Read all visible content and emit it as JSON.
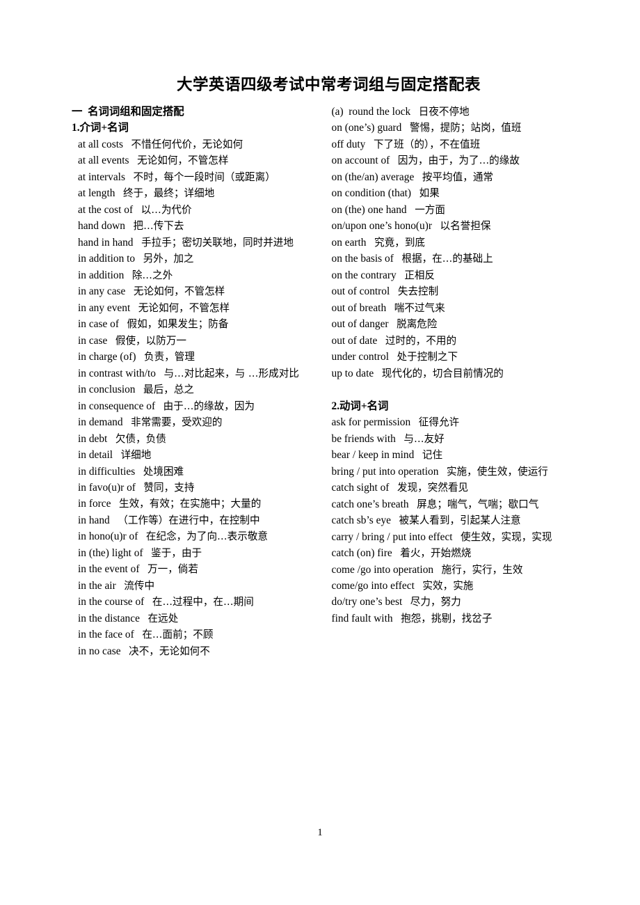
{
  "document": {
    "title": "大学英语四级考试中常考词组与固定搭配表",
    "page_number": "1"
  },
  "left_column": {
    "section_heading": "一  名词词组和固定搭配",
    "subsection_heading": "1.介词+名词",
    "entries": [
      {
        "en": "at all costs",
        "zh": "不惜任何代价，无论如何",
        "indent": true
      },
      {
        "en": "at all events",
        "zh": "无论如何，不管怎样",
        "indent": true
      },
      {
        "en": "at intervals",
        "zh": "不时，每个一段时间（或距离）",
        "indent": true
      },
      {
        "en": "at length",
        "zh": "终于，最终；详细地",
        "indent": true
      },
      {
        "en": "at the cost of",
        "zh": "以…为代价",
        "indent": true
      },
      {
        "en": "hand down",
        "zh": "把…传下去",
        "indent": true
      },
      {
        "en": "hand in hand",
        "zh": "手拉手；密切关联地，同时并进地",
        "indent": true
      },
      {
        "en": "in addition to",
        "zh": "另外，加之",
        "indent": true
      },
      {
        "en": "in addition",
        "zh": "除…之外",
        "indent": true
      },
      {
        "en": "in any case",
        "zh": "无论如何，不管怎样",
        "indent": true
      },
      {
        "en": "in any event",
        "zh": "无论如何，不管怎样",
        "indent": true
      },
      {
        "en": "in case of",
        "zh": "假如，如果发生；防备",
        "indent": true
      },
      {
        "en": "in case",
        "zh": "假使，以防万一",
        "indent": true
      },
      {
        "en": "in charge (of)",
        "zh": "负责，管理",
        "indent": true
      },
      {
        "en": "in contrast with/to",
        "zh": "与…对比起来，与 …形成对比",
        "indent": true
      },
      {
        "en": "in conclusion",
        "zh": "最后，总之",
        "indent": true
      },
      {
        "en": "in consequence of",
        "zh": "由于…的缘故，因为",
        "indent": true
      },
      {
        "en": "in demand",
        "zh": "非常需要，受欢迎的",
        "indent": true
      },
      {
        "en": "in debt",
        "zh": "欠债，负债",
        "indent": true
      },
      {
        "en": "in detail",
        "zh": "详细地",
        "indent": true
      },
      {
        "en": "in difficulties",
        "zh": "处境困难",
        "indent": true
      },
      {
        "en": "in favo(u)r of",
        "zh": "赞同，支持",
        "indent": true
      },
      {
        "en": "in force",
        "zh": "生效，有效；在实施中；大量的",
        "indent": true
      },
      {
        "en": "in hand",
        "zh": "（工作等）在进行中，在控制中",
        "indent": true
      },
      {
        "en": "in hono(u)r of",
        "zh": "在纪念，为了向…表示敬意",
        "indent": true
      },
      {
        "en": "in (the) light of",
        "zh": "鉴于，由于",
        "indent": true
      },
      {
        "en": "in the event of",
        "zh": "万一，倘若",
        "indent": true
      },
      {
        "en": "in the air",
        "zh": "流传中",
        "indent": true
      },
      {
        "en": "in the course of",
        "zh": "在…过程中，在…期间",
        "indent": true
      },
      {
        "en": "in the distance",
        "zh": "在远处",
        "indent": true
      },
      {
        "en": "in the face of",
        "zh": "在…面前；不顾",
        "indent": true
      },
      {
        "en": "in no case",
        "zh": "决不，无论如何不",
        "indent": true
      }
    ]
  },
  "right_column": {
    "subsection_heading": "2.动词+名词",
    "entries_prepositional": [
      {
        "en": "(a)  round the lock",
        "zh": "日夜不停地"
      },
      {
        "en": "on (one’s) guard",
        "zh": "警惕，提防；站岗，值班"
      },
      {
        "en": "off duty",
        "zh": "下了班（的），不在值班"
      },
      {
        "en": "on account of",
        "zh": "因为，由于，为了…的缘故"
      },
      {
        "en": "on (the/an) average",
        "zh": "按平均值，通常"
      },
      {
        "en": "on condition (that)",
        "zh": "如果"
      },
      {
        "en": "on (the) one hand",
        "zh": "一方面"
      },
      {
        "en": "on/upon one’s hono(u)r",
        "zh": "以名誉担保"
      },
      {
        "en": "on earth",
        "zh": "究竟，到底"
      },
      {
        "en": "on the basis of",
        "zh": "根据，在…的基础上"
      },
      {
        "en": "on the contrary",
        "zh": "正相反"
      },
      {
        "en": "out of control",
        "zh": "失去控制"
      },
      {
        "en": "out of breath",
        "zh": "喘不过气来"
      },
      {
        "en": "out of danger",
        "zh": "脱离危险"
      },
      {
        "en": "out of date",
        "zh": "过时的，不用的"
      },
      {
        "en": "under control",
        "zh": "处于控制之下"
      },
      {
        "en": "up to date",
        "zh": "现代化的，切合目前情况的"
      }
    ],
    "entries_verbal": [
      {
        "en": "ask for permission",
        "zh": "征得允许"
      },
      {
        "en": "be friends with",
        "zh": "与…友好"
      },
      {
        "en": "bear / keep in mind",
        "zh": "记住"
      },
      {
        "en": "bring / put into operation",
        "zh": "实施，使生效，使运行"
      },
      {
        "en": "catch sight of",
        "zh": "发现，突然看见"
      },
      {
        "en": "catch one’s breath",
        "zh": "屏息；喘气，气喘；歇口气"
      },
      {
        "en": "catch sb’s eye",
        "zh": "被某人看到，引起某人注意"
      },
      {
        "en": "carry / bring / put into effect",
        "zh": "使生效，实现，实现"
      },
      {
        "en": "catch (on) fire",
        "zh": "着火，开始燃烧"
      },
      {
        "en": "come /go into operation",
        "zh": "施行，实行，生效"
      },
      {
        "en": "come/go into effect",
        "zh": "实效，实施"
      },
      {
        "en": "do/try one’s best",
        "zh": "尽力，努力"
      },
      {
        "en": "find fault with",
        "zh": "抱怨，挑剔，找岔子"
      }
    ]
  }
}
